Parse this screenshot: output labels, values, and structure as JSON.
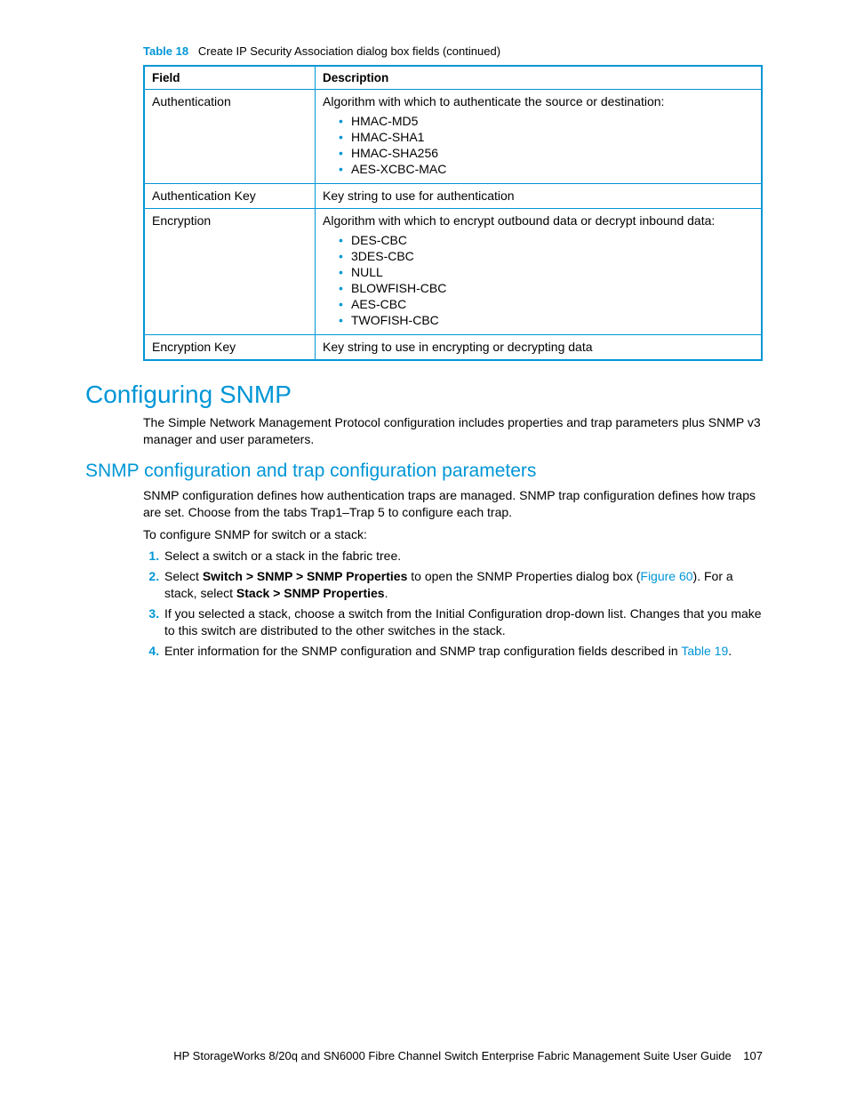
{
  "tableCaption": {
    "label": "Table 18",
    "text": "Create IP Security Association dialog box fields  (continued)"
  },
  "table": {
    "headers": {
      "field": "Field",
      "description": "Description"
    },
    "rows": {
      "auth": {
        "field": "Authentication",
        "desc": "Algorithm with which to authenticate the source or destination:",
        "items": [
          "HMAC-MD5",
          "HMAC-SHA1",
          "HMAC-SHA256",
          "AES-XCBC-MAC"
        ]
      },
      "authKey": {
        "field": "Authentication Key",
        "desc": "Key string to use for authentication"
      },
      "enc": {
        "field": "Encryption",
        "desc": "Algorithm with which to encrypt outbound data or decrypt inbound data:",
        "items": [
          "DES-CBC",
          "3DES-CBC",
          "NULL",
          "BLOWFISH-CBC",
          "AES-CBC",
          "TWOFISH-CBC"
        ]
      },
      "encKey": {
        "field": "Encryption Key",
        "desc": "Key string to use in encrypting or decrypting data"
      }
    }
  },
  "heading1": "Configuring SNMP",
  "para1": "The Simple Network Management Protocol configuration includes properties and trap parameters plus SNMP v3 manager and user parameters.",
  "heading2": "SNMP configuration and trap configuration parameters",
  "para2": "SNMP configuration defines how authentication traps are managed. SNMP trap configuration defines how traps are set. Choose from the tabs Trap1–Trap 5 to configure each trap.",
  "para3": "To configure SNMP for switch or a stack:",
  "steps": {
    "s1": "Select a switch or a stack in the fabric tree.",
    "s2a": "Select ",
    "s2b": "Switch > SNMP > SNMP Properties",
    "s2c": " to open the SNMP Properties dialog box (",
    "s2link": "Figure 60",
    "s2d": "). For a stack, select ",
    "s2e": "Stack > SNMP Properties",
    "s2f": ".",
    "s3": "If you selected a stack, choose a switch from the Initial Configuration drop-down list. Changes that you make to this switch are distributed to the other switches in the stack.",
    "s4a": "Enter information for the SNMP configuration and SNMP trap configuration fields described in ",
    "s4link": "Table 19",
    "s4b": "."
  },
  "footer": {
    "title": "HP StorageWorks 8/20q and SN6000 Fibre Channel Switch Enterprise Fabric Management Suite User Guide",
    "page": "107"
  }
}
